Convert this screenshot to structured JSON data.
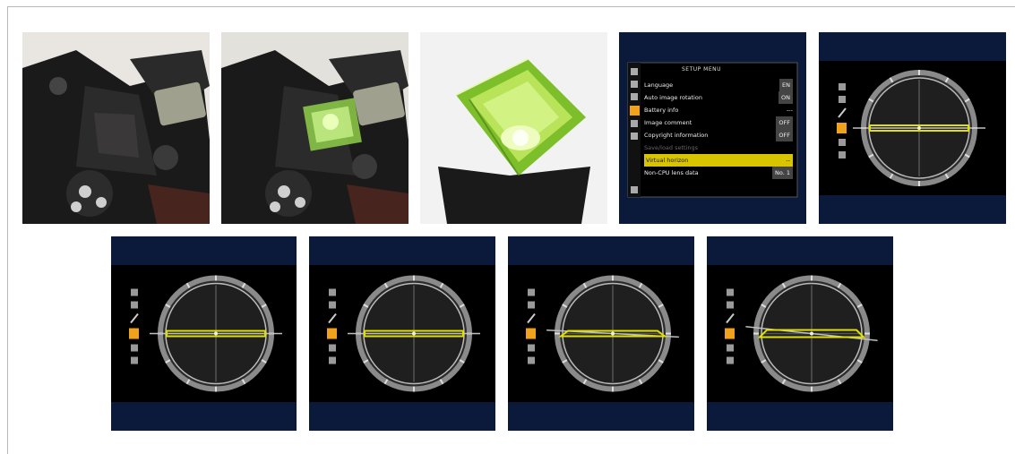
{
  "figure": {
    "panels": [
      {
        "name": "camera-top-plain",
        "kind": "photo"
      },
      {
        "name": "camera-top-with-level",
        "kind": "photo"
      },
      {
        "name": "hotshoe-bubble-level",
        "kind": "photo"
      },
      {
        "name": "setup-menu-screen",
        "kind": "screen"
      },
      {
        "name": "virtual-horizon-level-1",
        "kind": "screen",
        "tilt_deg": 0
      },
      {
        "name": "virtual-horizon-level-2",
        "kind": "screen",
        "tilt_deg": 0
      },
      {
        "name": "virtual-horizon-level-3",
        "kind": "screen",
        "tilt_deg": 0
      },
      {
        "name": "virtual-horizon-level-4",
        "kind": "screen",
        "tilt_deg": 1
      },
      {
        "name": "virtual-horizon-level-5",
        "kind": "screen",
        "tilt_deg": 2
      }
    ]
  },
  "setup_menu": {
    "title": "SETUP MENU",
    "items": [
      {
        "label": "Language",
        "value": "EN"
      },
      {
        "label": "Auto image rotation",
        "value": "ON"
      },
      {
        "label": "Battery info",
        "value": "---"
      },
      {
        "label": "Image comment",
        "value": "OFF"
      },
      {
        "label": "Copyright information",
        "value": "OFF"
      },
      {
        "label": "Save/load settings",
        "value": ""
      },
      {
        "label": "Virtual horizon",
        "value": "--"
      },
      {
        "label": "Non-CPU lens data",
        "value": "No. 1"
      }
    ],
    "highlighted_index": 6
  },
  "colors": {
    "screen_bg": "#000000",
    "screen_band": "#0b1a3a",
    "accent_yellow": "#e2e000",
    "menu_highlight": "#d8c400",
    "orange_tab": "#f0a21c",
    "bubble_green": "#b9e45a"
  }
}
